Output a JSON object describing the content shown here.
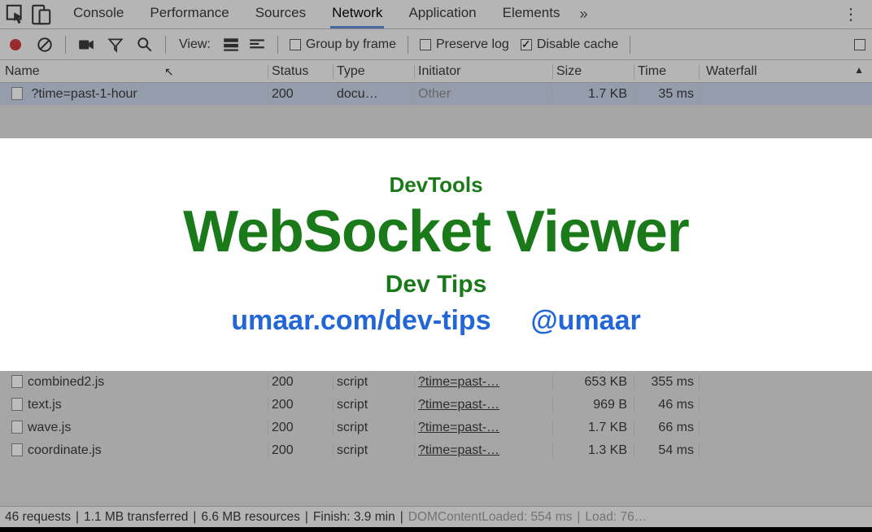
{
  "tabs": [
    "Console",
    "Performance",
    "Sources",
    "Network",
    "Application",
    "Elements"
  ],
  "active_tab": "Network",
  "more_glyph": "»",
  "toolbar": {
    "view_label": "View:",
    "group_by_frame": "Group by frame",
    "preserve_log": "Preserve log",
    "disable_cache": "Disable cache",
    "disable_cache_checked": true
  },
  "columns": {
    "name": "Name",
    "status": "Status",
    "type": "Type",
    "initiator": "Initiator",
    "size": "Size",
    "time": "Time",
    "waterfall": "Waterfall"
  },
  "rows_top": [
    {
      "name": "?time=past-1-hour",
      "status": "200",
      "type": "docu…",
      "initiator": "Other",
      "initiator_dim": true,
      "size": "1.7 KB",
      "time": "35 ms",
      "selected": true
    }
  ],
  "rows_bottom": [
    {
      "name": "combined2.js",
      "status": "200",
      "type": "script",
      "initiator": "?time=past-…",
      "size": "653 KB",
      "time": "355 ms"
    },
    {
      "name": "text.js",
      "status": "200",
      "type": "script",
      "initiator": "?time=past-…",
      "size": "969 B",
      "time": "46 ms"
    },
    {
      "name": "wave.js",
      "status": "200",
      "type": "script",
      "initiator": "?time=past-…",
      "size": "1.7 KB",
      "time": "66 ms"
    },
    {
      "name": "coordinate.js",
      "status": "200",
      "type": "script",
      "initiator": "?time=past-…",
      "size": "1.3 KB",
      "time": "54 ms"
    }
  ],
  "statusbar": {
    "requests": "46 requests",
    "transferred": "1.1 MB transferred",
    "resources": "6.6 MB resources",
    "finish": "Finish: 3.9 min",
    "domcontentloaded": "DOMContentLoaded: 554 ms",
    "load": "Load: 76…"
  },
  "overlay": {
    "line1": "DevTools",
    "line2": "WebSocket Viewer",
    "line3": "Dev Tips",
    "url": "umaar.com/dev-tips",
    "handle": "@umaar"
  }
}
